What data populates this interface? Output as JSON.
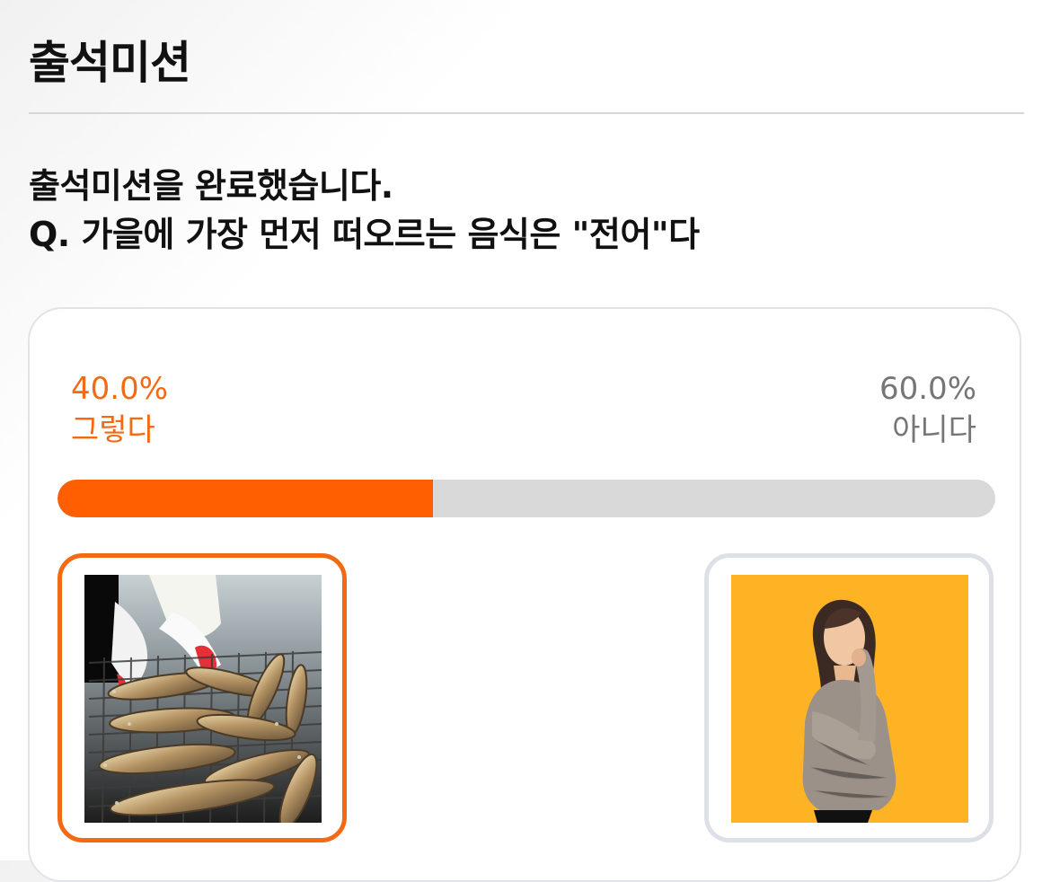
{
  "header": {
    "title": "출석미션"
  },
  "mission": {
    "completion_message": "출석미션을 완료했습니다.",
    "question": "Q. 가을에 가장 먼저 떠오르는 음식은 \"전어\"다"
  },
  "poll": {
    "options": [
      {
        "percent": "40.0%",
        "label": "그렇다",
        "selected": true,
        "image_icon": "grilled-fish-photo",
        "share": 40
      },
      {
        "percent": "60.0%",
        "label": "아니다",
        "selected": false,
        "image_icon": "thinking-woman-photo",
        "share": 60
      }
    ],
    "colors": {
      "selected": "#f36a14",
      "progress_fill": "#ff5f00",
      "progress_track": "#d9d9d9",
      "unselected_text": "#767676",
      "unselected_border": "#dde1e7"
    }
  }
}
